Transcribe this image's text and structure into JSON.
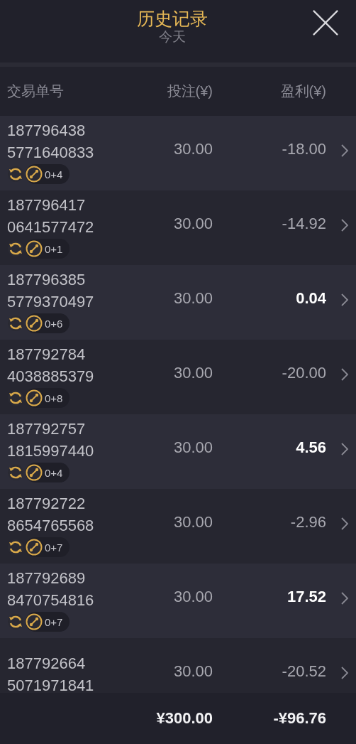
{
  "header": {
    "title": "历史记录",
    "subtitle": "今天"
  },
  "table": {
    "columns": [
      "交易单号",
      "投注(¥)",
      "盈利(¥)"
    ],
    "rows": [
      {
        "order_lines": [
          "187796438",
          "5771640833"
        ],
        "badge": "0+4",
        "stake": "30.00",
        "profit": "-18.00",
        "win": false
      },
      {
        "order_lines": [
          "187796417",
          "0641577472"
        ],
        "badge": "0+1",
        "stake": "30.00",
        "profit": "-14.92",
        "win": false
      },
      {
        "order_lines": [
          "187796385",
          "5779370497"
        ],
        "badge": "0+6",
        "stake": "30.00",
        "profit": "0.04",
        "win": true
      },
      {
        "order_lines": [
          "187792784",
          "4038885379"
        ],
        "badge": "0+8",
        "stake": "30.00",
        "profit": "-20.00",
        "win": false
      },
      {
        "order_lines": [
          "187792757",
          "1815997440"
        ],
        "badge": "0+4",
        "stake": "30.00",
        "profit": "4.56",
        "win": true
      },
      {
        "order_lines": [
          "187792722",
          "8654765568"
        ],
        "badge": "0+7",
        "stake": "30.00",
        "profit": "-2.96",
        "win": false
      },
      {
        "order_lines": [
          "187792689",
          "8470754816"
        ],
        "badge": "0+7",
        "stake": "30.00",
        "profit": "17.52",
        "win": true
      },
      {
        "order_lines": [
          "187792664",
          "5071971841"
        ],
        "stake": "30.00",
        "profit": "-20.52",
        "win": false
      }
    ]
  },
  "totals": {
    "stake": "¥300.00",
    "profit": "-¥96.76"
  }
}
